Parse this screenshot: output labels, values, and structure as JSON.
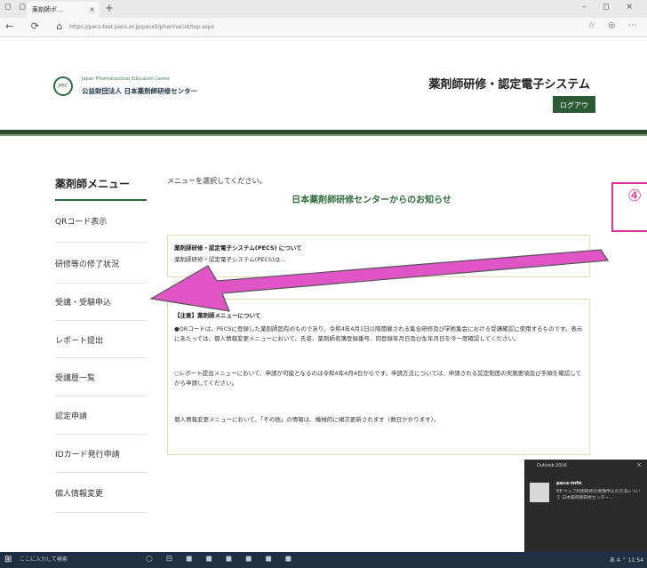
{
  "browser": {
    "tab_title": "薬剤師ポ...",
    "tab_close": "×",
    "new_tab": "+",
    "window_icons": "◻ ◻",
    "window_controls": "– ◻ ×",
    "nav_buttons": "← ⟳ ⌂",
    "url": "https://pecs-test.pecs.or.jp/pecs3/pharmacist/top.aspx",
    "nav_right": "☆ ◎ ⋯"
  },
  "header": {
    "logo_mark": "JPEC",
    "logo_en": "Japan Pharmaceutical Education Center",
    "logo_jp": "公益財団法人 日本薬剤師研修センター",
    "system_title": "薬剤師研修・認定電子システム",
    "logout_label": "ログアウト"
  },
  "sidebar": {
    "title": "薬剤師メニュー",
    "items": [
      {
        "label": "QRコード表示"
      },
      {
        "label": "研修等の修了状況"
      },
      {
        "label": "受講・受験申込"
      },
      {
        "label": "レポート提出"
      },
      {
        "label": "受講歴一覧"
      },
      {
        "label": "認定申請"
      },
      {
        "label": "IDカード発行申請"
      },
      {
        "label": "個人情報変更"
      }
    ]
  },
  "main": {
    "instruction": "メニューを選択してください。",
    "notice_title": "日本薬剤師研修センターからのお知らせ",
    "box1": {
      "head": "薬剤師研修・認定電子システム(PECS) について",
      "text": "薬剤師研修・認定電子システム(PECS)は..."
    },
    "box2": {
      "head": "【注意】薬剤師メニューについて",
      "p1": "●QRコードは、PECSに登録した薬剤師固有のものであり、令和4年4月1日以降開催される集合研修及び学術集会における受講確認に使用するものです。表示にあたっては、個人情報変更メニューにおいて、氏名、薬剤師名簿登録番号、同登録年月日及び生年月日を今一度確認してください。",
      "p2": "○レポート提出メニューにおいて、申請が可能となるのは令和4年4月4日からです。申請方法については、申請される認定制度の実施要領及び手順を確認してから申請してください。",
      "p3": "個人情報変更メニューにおいて、「その他」の情報は、機械的に順次更新されます（数日かかります）。"
    }
  },
  "annotation": {
    "number": "④",
    "color": "#d9348f"
  },
  "toast": {
    "app": "Outlook 2016",
    "close": "×",
    "sender": "pecs-info",
    "body": "RE:ウェブ利用研修の受講申込の方法について 日本薬剤師研修センター..."
  },
  "taskbar": {
    "start": "⊞",
    "search_placeholder": "ここに入力して検索",
    "icons": "○ ⊟ ◼ ◼ ◼ ◼ ◼ ◼",
    "tray": "あ A ⌃ 11:54"
  },
  "colors": {
    "brand_green": "#2c5a34",
    "notice_green": "#2e6b3a",
    "box_border": "#e6dcae"
  }
}
